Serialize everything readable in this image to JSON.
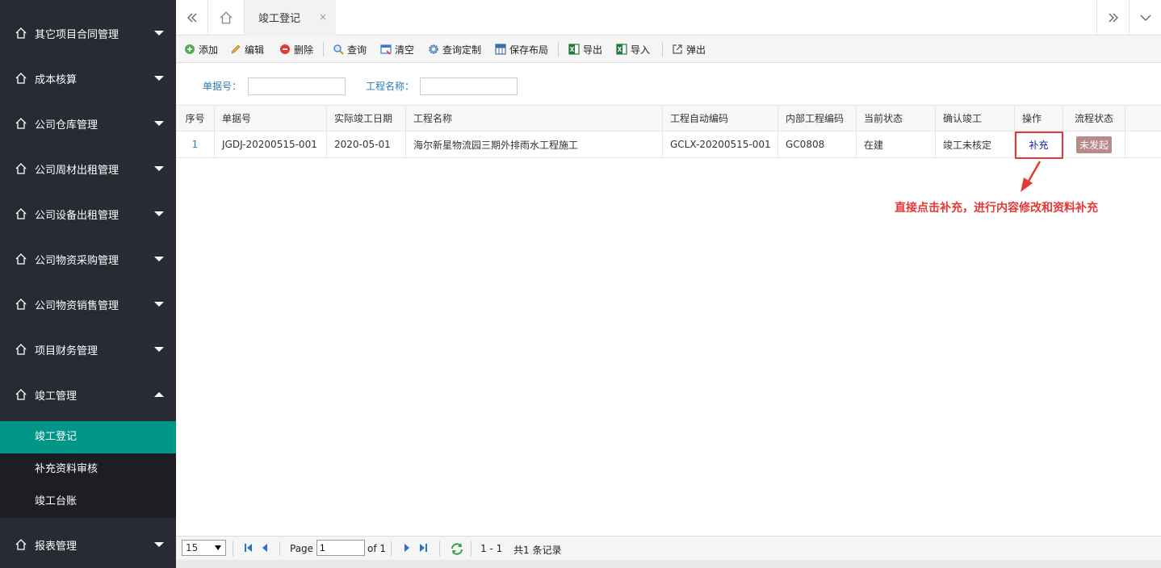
{
  "sidebar": {
    "items": [
      {
        "label": "其它项目合同管理"
      },
      {
        "label": "成本核算"
      },
      {
        "label": "公司仓库管理"
      },
      {
        "label": "公司周材出租管理"
      },
      {
        "label": "公司设备出租管理"
      },
      {
        "label": "公司物资采购管理"
      },
      {
        "label": "公司物资销售管理"
      },
      {
        "label": "项目财务管理"
      },
      {
        "label": "竣工管理"
      },
      {
        "label": "报表管理"
      }
    ],
    "submenu": [
      {
        "label": "竣工登记"
      },
      {
        "label": "补充资料审核"
      },
      {
        "label": "竣工台账"
      }
    ]
  },
  "tabbar": {
    "active_tab": "竣工登记",
    "close_glyph": "×"
  },
  "toolbar": {
    "add": "添加",
    "edit": "编辑",
    "delete": "删除",
    "query": "查询",
    "clear": "清空",
    "query_custom": "查询定制",
    "save_layout": "保存布局",
    "export": "导出",
    "import": "导入",
    "popup": "弹出"
  },
  "search": {
    "doc_no_label": "单据号：",
    "doc_no_value": "",
    "project_name_label": "工程名称：",
    "project_name_value": ""
  },
  "table": {
    "columns": [
      "序号",
      "单据号",
      "实际竣工日期",
      "工程名称",
      "工程自动编码",
      "内部工程编码",
      "当前状态",
      "确认竣工",
      "操作",
      "流程状态"
    ],
    "rows": [
      {
        "seq": "1",
        "doc_no": "JGDJ-20200515-001",
        "completion_date": "2020-05-01",
        "project_name": "海尔新星物流园三期外排雨水工程施工",
        "auto_code": "GCLX-20200515-001",
        "internal_code": "GC0808",
        "status": "在建",
        "confirm": "竣工未核定",
        "action": "补充",
        "flow_status": "未发起"
      }
    ]
  },
  "annotation": "直接点击补充，进行内容修改和资料补充",
  "pager": {
    "page_size": "15",
    "page_label": "Page",
    "page_value": "1",
    "of_label": "of 1",
    "range": "1 - 1",
    "total": "共1 条记录"
  },
  "colors": {
    "sidebar_bg": "#282b33",
    "active_sub": "#009688",
    "annotation_red": "#e53935",
    "badge": "#b88a8a"
  }
}
